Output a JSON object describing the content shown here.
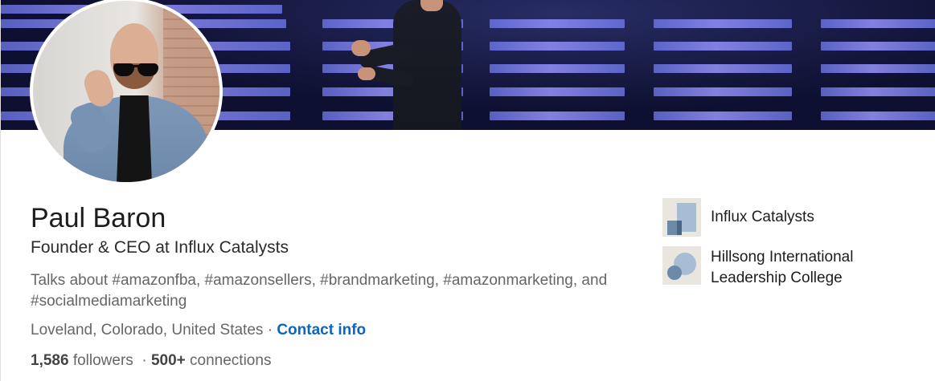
{
  "profile": {
    "name": "Paul Baron",
    "headline": "Founder & CEO at Influx Catalysts",
    "talks_about": "Talks about #amazonfba, #amazonsellers, #brandmarketing, #amazonmarketing, and #socialmediamarketing",
    "location": "Loveland, Colorado, United States",
    "separator": " · ",
    "contact_info_label": "Contact info",
    "followers_count": "1,586",
    "followers_label": " followers",
    "connections_sep": "  · ",
    "connections_count": "500+",
    "connections_label": " connections"
  },
  "organizations": [
    {
      "name": "Influx Catalysts",
      "logo_icon": "company-logo-icon"
    },
    {
      "name": "Hillsong International Leadership College",
      "logo_icon": "school-logo-icon"
    }
  ],
  "colors": {
    "link": "#0a66c2",
    "text_primary": "#1d1d1d",
    "text_secondary": "#666666"
  }
}
